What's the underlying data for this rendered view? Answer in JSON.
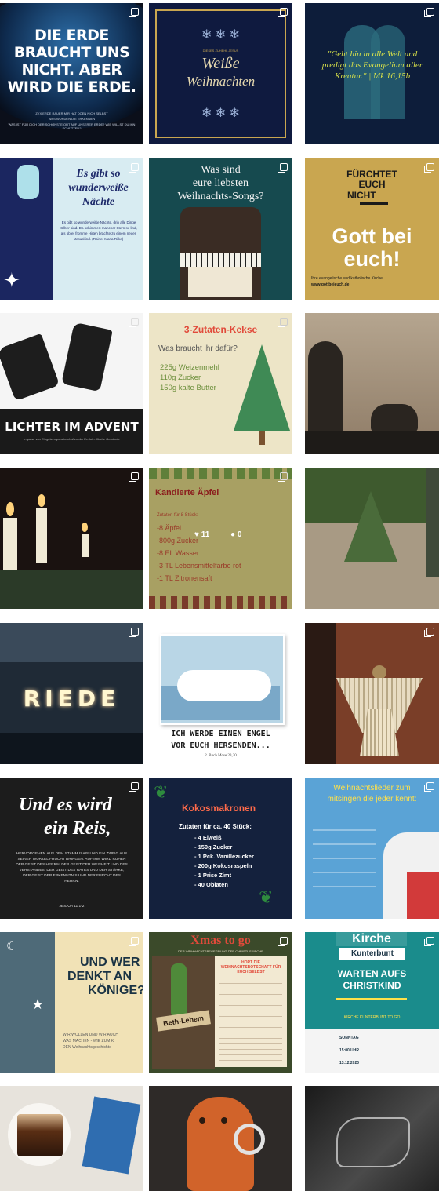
{
  "posts": {
    "p1": {
      "headline": "DIE ERDE BRAUCHT UNS NICHT. ABER WIRD DIE ERDE.",
      "small1": "ZYX ERDE RAUER MIR HAT DOEN NICH SELBST",
      "small2": "WAS WÜRDEN DIE ERKENNEN",
      "small3": "WAS IST FÜR DICH DER SCHÖNSTE ORT AUF UNSERER ERDE? WIE WILLST DU IHN SCHÜTZEN?"
    },
    "p2": {
      "small": "DIESES ZUHEHL JESUS",
      "title1": "Weiße",
      "title2": "Weihnachten",
      "stars": "❄ ❄ ❄"
    },
    "p3": {
      "quote": "\"Geht hin in alle Welt und predigt das Evangelium aller Kreatur.\" | Mk 16,15b"
    },
    "p4": {
      "heading1": "Es gibt so",
      "heading2": "wunderweiße",
      "heading3": "Nächte",
      "body": "Es gibt so wunderweiße Nächte, drin alle Dinge Silber sind. Da schimmert mancher Stern so lind, als ob er fromme Hirten brächte zu einem neuen Jesuskind. (Rainer Maria Rilke)"
    },
    "p5": {
      "title1": "Was sind",
      "title2": "eure liebsten",
      "title3": "Weihnachts-Songs?"
    },
    "p6": {
      "top1": "FÜRCHTET",
      "top2": "EUCH",
      "top3": "NICHT",
      "big1": "Gott bei",
      "big2": "euch!",
      "footer": "Ihre evangelische und katholische Kirche",
      "url": "www.gottbeieuch.de"
    },
    "p7": {
      "title": "LICHTER IM ADVENT",
      "sub": "Impulse von Ehrgeizengemeinschaften der Ev.-luth. Kirche Gemünde"
    },
    "p8": {
      "title": "3-Zutaten-Kekse",
      "question": "Was braucht ihr dafür?",
      "i1": "225g Weizenmehl",
      "i2": "110g Zucker",
      "i3": "150g kalte Butter"
    },
    "p10": {
      "title": "Kandierte Äpfel",
      "sub": "Zutaten für 8 Stück:",
      "i1": "-8 Äpfel",
      "i2": "-800g Zucker",
      "i3": "-8 EL Wasser",
      "i4": "-3 TL Lebensmittelfarbe rot",
      "i5": "-1 TL Zitronensaft",
      "likes": "11",
      "comments": "0"
    },
    "p13": {
      "word": "RIEDE"
    },
    "p14": {
      "title1": "ICH WERDE EINEN ENGEL",
      "title2": "VOR EUCH HERSENDEN...",
      "ref": "2. Buch Mose 23,20"
    },
    "p16": {
      "title1": "Und es wird",
      "title2": "ein Reis,",
      "body": "HERVORGEHEN AUS DEM STAMM ISAIS UND EIN ZWEIG AUS SEINER WURZEL FRUCHT BRINGEN. AUF IHM WIRD RUHEN DER GEIST DES HERRN, DER GEIST DER WEISHEIT UND DES VERSTANDES, DER GEIST DES RATES UND DER STÄRKE, DER GEIST DER ERKENNTNIS UND DER FURCHT DES HERRN.",
      "ref": "JESAJA 11,1-2"
    },
    "p17": {
      "title": "Kokosmakronen",
      "sub": "Zutaten für ca. 40 Stück:",
      "i1": "- 4 Eiweiß",
      "i2": "- 150g Zucker",
      "i3": "- 1 Pck. Vanillezucker",
      "i4": "- 200g Kokosraspeln",
      "i5": "- 1 Prise Zimt",
      "i6": "- 40 Oblaten"
    },
    "p18": {
      "title1": "Weihnachtslieder zum",
      "title2": "mitsingen die jeder kennt:"
    },
    "p19": {
      "title1": "UND WER",
      "title2": "DENKT AN",
      "title3": "KÖNIGE?",
      "small1": "WIR WOLLEN UND WIR AUCH",
      "small2": "WAS MACHEN - WIE ZUM K",
      "small3": "DEN Weihnachtsgeschichte"
    },
    "p20": {
      "title": "Xmas to go",
      "sub": "DER WEIHNACHTSBEGEGNUNG DER CHRISTUSKIRCHE",
      "sign": "Beth-Lehem",
      "box": "HÖRT DIE WEIHNACHTSBOTSCHAFT FÜR EUCH SELBST"
    },
    "p21": {
      "banner": "Kirche",
      "sub": "Kunterbunt",
      "title1": "WARTEN AUFS",
      "title2": "CHRISTKIND",
      "line1": "KIRCHE KUNTERBUNT TO GO",
      "day": "SONNTAG",
      "time": "15:00 UHR",
      "date": "13.12.2020"
    }
  },
  "colors": {
    "navy": "#14213d",
    "gold": "#c9a650",
    "cream": "#ede5c7",
    "olive": "#a8a063",
    "teal": "#1a8c8c",
    "sky": "#5aa3d6"
  },
  "icons": [
    "multi-image-icon",
    "heart-icon",
    "comment-icon",
    "star-icon",
    "snowflake-icon"
  ]
}
